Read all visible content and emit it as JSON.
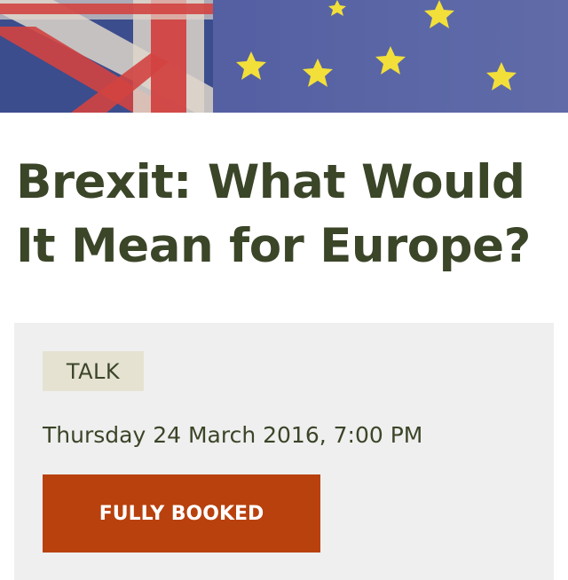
{
  "event": {
    "title": "Brexit: What Would It Mean for Europe?",
    "category": "TALK",
    "datetime": "Thursday 24 March 2016, 7:00 PM",
    "booking_label": "FULLY BOOKED"
  },
  "hero_image": {
    "icon": "uk-eu-flags-banner"
  },
  "colors": {
    "title_text": "#3b4528",
    "panel_background": "#efefef",
    "tag_background": "#e5e2d2",
    "button_background": "#b8410e",
    "button_text": "#ffffff"
  }
}
